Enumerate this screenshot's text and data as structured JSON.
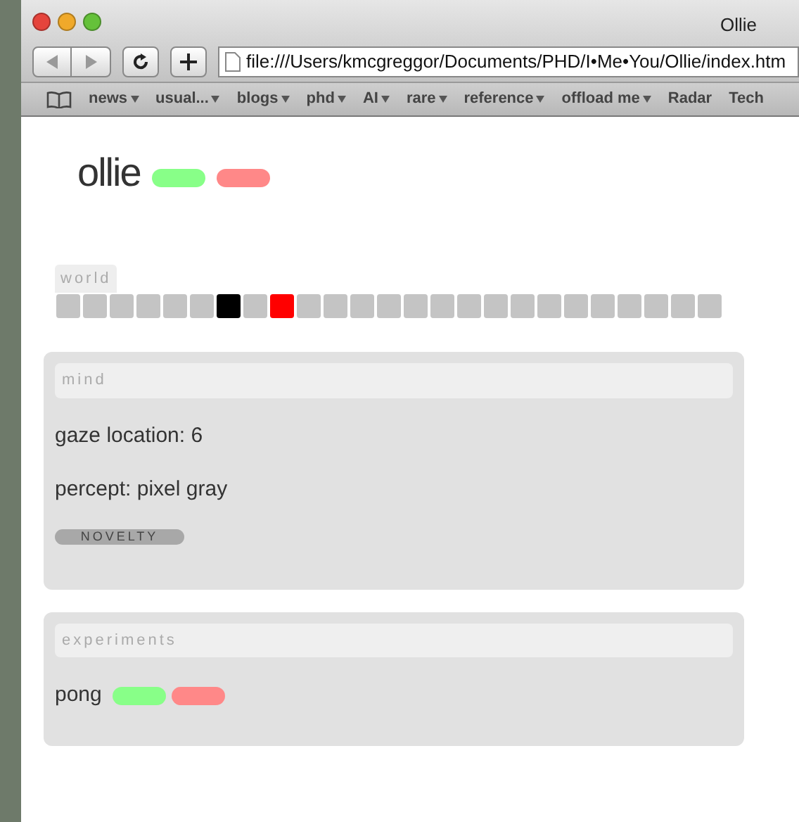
{
  "window": {
    "title": "Ollie"
  },
  "toolbar": {
    "address": "file:///Users/kmcgreggor/Documents/PHD/I•Me•You/Ollie/index.htm"
  },
  "bookmarks": [
    {
      "label": "news",
      "menu": true
    },
    {
      "label": "usual...",
      "menu": true
    },
    {
      "label": "blogs",
      "menu": true
    },
    {
      "label": "phd",
      "menu": true
    },
    {
      "label": "AI",
      "menu": true
    },
    {
      "label": "rare",
      "menu": true
    },
    {
      "label": "reference",
      "menu": true
    },
    {
      "label": "offload me",
      "menu": true
    },
    {
      "label": "Radar",
      "menu": false
    },
    {
      "label": "Tech",
      "menu": false
    }
  ],
  "page": {
    "title": "ollie",
    "buttons": [
      {
        "color": "#88ff88"
      },
      {
        "color": "#ff8888"
      }
    ]
  },
  "world": {
    "label": "world",
    "cells": [
      {
        "color": "#c4c4c4"
      },
      {
        "color": "#c4c4c4"
      },
      {
        "color": "#c4c4c4"
      },
      {
        "color": "#c4c4c4"
      },
      {
        "color": "#c4c4c4"
      },
      {
        "color": "#c4c4c4"
      },
      {
        "color": "#000000"
      },
      {
        "color": "#c4c4c4"
      },
      {
        "color": "#ff0000"
      },
      {
        "color": "#c4c4c4"
      },
      {
        "color": "#c4c4c4"
      },
      {
        "color": "#c4c4c4"
      },
      {
        "color": "#c4c4c4"
      },
      {
        "color": "#c4c4c4"
      },
      {
        "color": "#c4c4c4"
      },
      {
        "color": "#c4c4c4"
      },
      {
        "color": "#c4c4c4"
      },
      {
        "color": "#c4c4c4"
      },
      {
        "color": "#c4c4c4"
      },
      {
        "color": "#c4c4c4"
      },
      {
        "color": "#c4c4c4"
      },
      {
        "color": "#c4c4c4"
      },
      {
        "color": "#c4c4c4"
      },
      {
        "color": "#c4c4c4"
      },
      {
        "color": "#c4c4c4"
      }
    ]
  },
  "mind": {
    "label": "mind",
    "lines": [
      "gaze location: 6",
      "percept: pixel gray"
    ],
    "badge": "NOVELTY"
  },
  "experiments": {
    "label": "experiments",
    "items": [
      {
        "name": "pong",
        "buttons": [
          {
            "color": "#88ff88"
          },
          {
            "color": "#ff8888"
          }
        ]
      }
    ]
  }
}
